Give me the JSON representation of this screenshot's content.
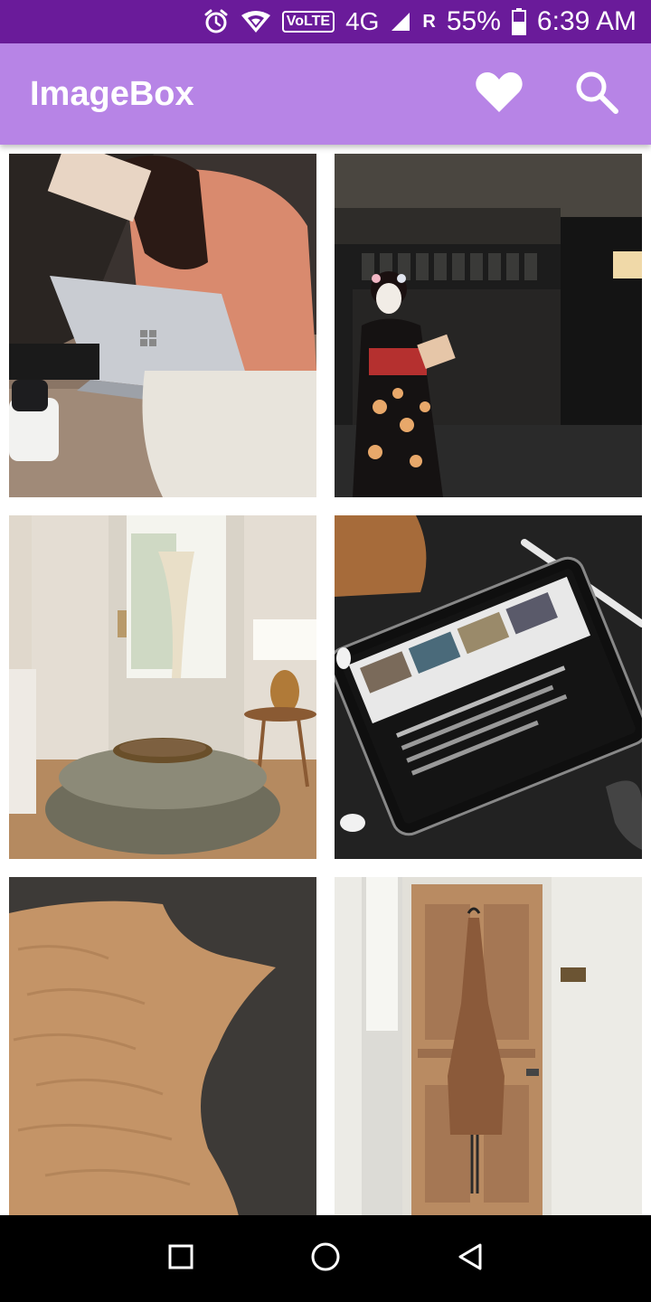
{
  "status_bar": {
    "network_label": "VoLTE",
    "network_type": "4G",
    "roaming": "R",
    "battery": "55%",
    "time": "6:39 AM",
    "icons": [
      "alarm-icon",
      "wifi-icon",
      "signal-icon",
      "battery-icon"
    ]
  },
  "app_bar": {
    "title": "ImageBox",
    "actions": [
      {
        "name": "favorites",
        "icon": "heart-icon"
      },
      {
        "name": "search",
        "icon": "search-icon"
      }
    ],
    "color": "#b784e6"
  },
  "colors": {
    "status_bar": "#6a1b9a",
    "app_bar": "#b784e6",
    "nav_bar": "#000000"
  },
  "grid": {
    "tiles": [
      {
        "subject": "woman with laptop on floor"
      },
      {
        "subject": "geisha in kimono by dark building"
      },
      {
        "subject": "living room with ottoman and lamp"
      },
      {
        "subject": "tablet on dark desk with pencil"
      },
      {
        "subject": "sand dune against dark sky"
      },
      {
        "subject": "wooden door with apron hanging"
      }
    ]
  },
  "nav_bar": {
    "buttons": [
      "recents-icon",
      "home-icon",
      "back-icon"
    ]
  }
}
